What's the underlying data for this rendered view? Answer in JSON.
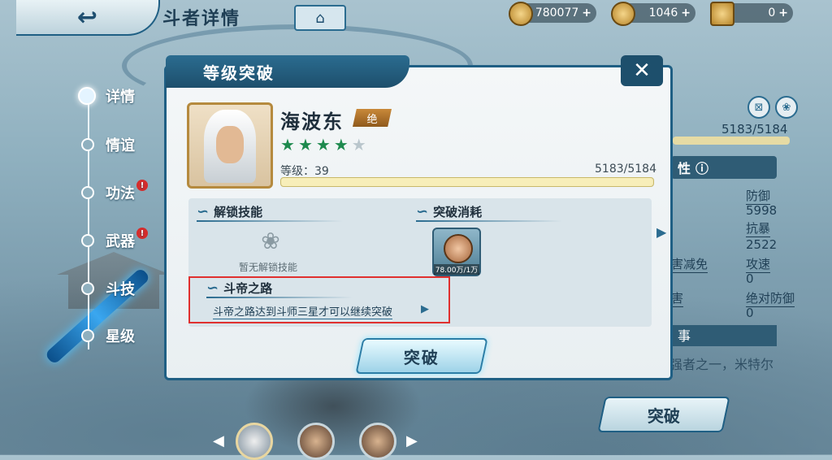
{
  "top": {
    "title": "斗者详情",
    "resources": [
      {
        "value": "780077",
        "plus": "+"
      },
      {
        "value": "1046",
        "plus": "+"
      },
      {
        "value": "0",
        "plus": "+"
      }
    ]
  },
  "nav": [
    {
      "label": "详情",
      "badge": null
    },
    {
      "label": "情谊",
      "badge": null
    },
    {
      "label": "功法",
      "badge": "!"
    },
    {
      "label": "武器",
      "badge": "!"
    },
    {
      "label": "斗技",
      "badge": null
    },
    {
      "label": "星级",
      "badge": null
    }
  ],
  "right_panel": {
    "level": "5183/5184",
    "attr_header": "性",
    "cells": [
      "防御",
      "5998",
      "抗暴",
      "2522",
      "害减免",
      "攻速",
      "0",
      "害",
      "绝对防御",
      "0"
    ],
    "story_header": "事",
    "desc": "外号［冰皇］，加玛帝国最强者之一，米特尔",
    "break_button": "突破"
  },
  "dialog": {
    "title": "等级突破",
    "close": "✕",
    "hero_name": "海波东",
    "rank": "绝",
    "stars_on": 4,
    "stars_total": 5,
    "level_label": "等级：39",
    "level_value": "5183/5184",
    "level_progress": 0.998,
    "unlock_title": "解锁技能",
    "no_skill": "暂无解锁技能",
    "cost_title": "突破消耗",
    "cost_amount": "78.00万/1万",
    "road_title": "斗帝之路",
    "road_text": "斗帝之路达到斗师三星才可以继续突破",
    "break_button": "突破"
  }
}
